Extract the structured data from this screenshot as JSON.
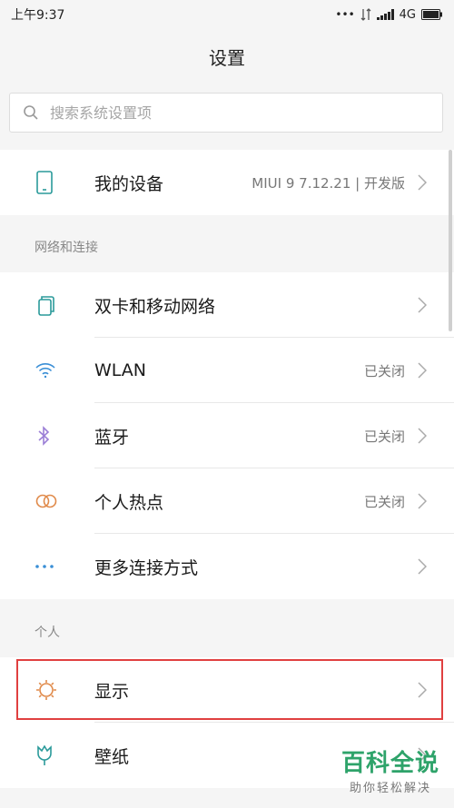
{
  "status_bar": {
    "time": "上午9:37",
    "dots": "•••",
    "network": "4G"
  },
  "header": {
    "title": "设置"
  },
  "search": {
    "placeholder": "搜索系统设置项"
  },
  "device": {
    "label": "我的设备",
    "value": "MIUI 9 7.12.21 | 开发版"
  },
  "sections": [
    {
      "title": "网络和连接",
      "items": [
        {
          "label": "双卡和移动网络",
          "value": "",
          "icon": "sim-cards-icon"
        },
        {
          "label": "WLAN",
          "value": "已关闭",
          "icon": "wifi-icon"
        },
        {
          "label": "蓝牙",
          "value": "已关闭",
          "icon": "bluetooth-icon"
        },
        {
          "label": "个人热点",
          "value": "已关闭",
          "icon": "hotspot-icon"
        },
        {
          "label": "更多连接方式",
          "value": "",
          "icon": "more-dots-icon"
        }
      ]
    },
    {
      "title": "个人",
      "items": [
        {
          "label": "显示",
          "value": "",
          "icon": "display-brightness-icon"
        },
        {
          "label": "壁纸",
          "value": "",
          "icon": "wallpaper-tulip-icon"
        }
      ]
    }
  ],
  "watermark": {
    "title": "百科全说",
    "subtitle": "助你轻松解决"
  },
  "colors": {
    "highlight": "#e04040",
    "watermark": "#2ea36a",
    "icon_teal": "#2a9a9a",
    "icon_blue": "#3a8fd6",
    "icon_purple": "#9b7fd6",
    "icon_orange": "#e08a4a"
  }
}
